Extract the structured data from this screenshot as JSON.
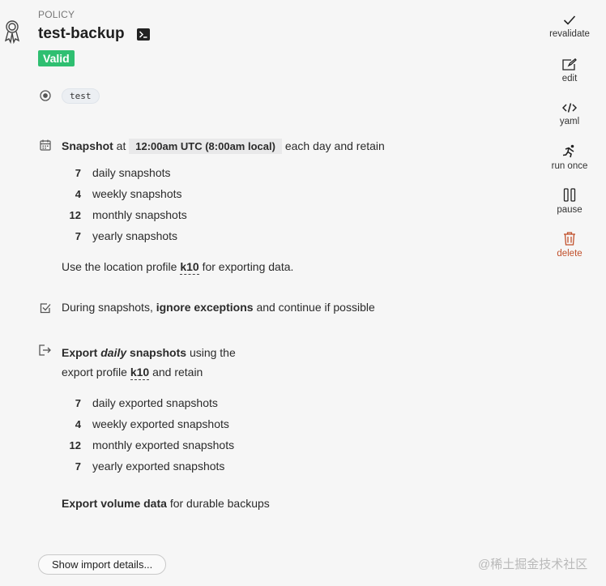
{
  "header": {
    "overline": "POLICY",
    "title": "test-backup",
    "status": "Valid"
  },
  "selector": {
    "tag": "test"
  },
  "snapshot": {
    "prefix": "Snapshot",
    "at": "at",
    "time": "12:00am UTC (8:00am local)",
    "suffix": "each day and retain",
    "retention": [
      {
        "count": "7",
        "label": "daily snapshots"
      },
      {
        "count": "4",
        "label": "weekly snapshots"
      },
      {
        "count": "12",
        "label": "monthly snapshots"
      },
      {
        "count": "7",
        "label": "yearly snapshots"
      }
    ],
    "location_prefix": "Use the location profile",
    "location_profile": "k10",
    "location_suffix": "for exporting data."
  },
  "exceptions": {
    "prefix": "During snapshots,",
    "bold": "ignore exceptions",
    "suffix": "and continue if possible"
  },
  "export": {
    "export_word": "Export",
    "frequency": "daily",
    "snapshots_word": "snapshots",
    "using": "using the",
    "line2_prefix": "export profile",
    "profile": "k10",
    "line2_suffix": "and retain",
    "retention": [
      {
        "count": "7",
        "label": "daily exported snapshots"
      },
      {
        "count": "4",
        "label": "weekly exported snapshots"
      },
      {
        "count": "12",
        "label": "monthly exported snapshots"
      },
      {
        "count": "7",
        "label": "yearly exported snapshots"
      }
    ],
    "volume_bold": "Export volume data",
    "volume_suffix": "for durable backups"
  },
  "actions": [
    {
      "label": "revalidate",
      "icon": "check-icon"
    },
    {
      "label": "edit",
      "icon": "edit-icon"
    },
    {
      "label": "yaml",
      "icon": "code-icon"
    },
    {
      "label": "run once",
      "icon": "run-icon"
    },
    {
      "label": "pause",
      "icon": "pause-icon"
    },
    {
      "label": "delete",
      "icon": "trash-icon"
    }
  ],
  "footer": {
    "import_button": "Show import details...",
    "watermark": "@稀土掘金技术社区"
  },
  "colors": {
    "valid": "#2fbf71",
    "delete": "#c1502b",
    "background": "#f6f6f6"
  }
}
